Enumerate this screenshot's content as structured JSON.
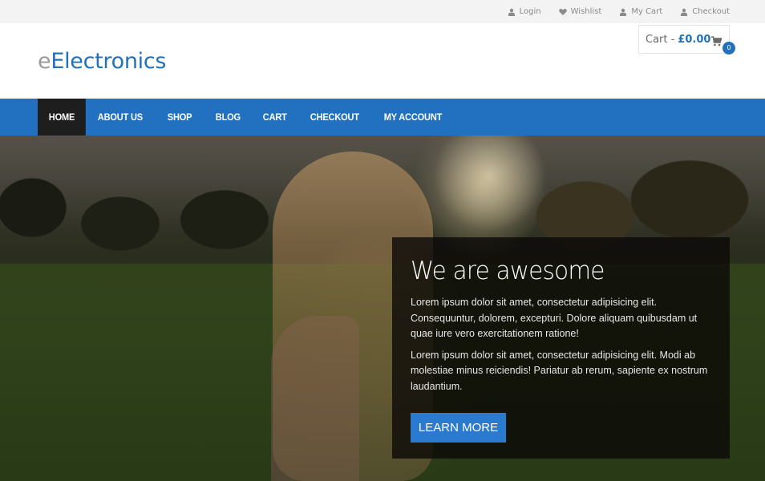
{
  "topbar": {
    "links": [
      {
        "label": "Login",
        "icon": "user-icon"
      },
      {
        "label": "Wishlist",
        "icon": "heart-icon"
      },
      {
        "label": "My Cart",
        "icon": "user-icon"
      },
      {
        "label": "Checkout",
        "icon": "user-icon"
      }
    ]
  },
  "header": {
    "logo_prefix": "e",
    "logo_rest": "Electronics",
    "cart": {
      "label": "Cart -",
      "amount": "£0.00",
      "count": "0",
      "icon": "shopping-cart-icon"
    }
  },
  "nav": {
    "items": [
      {
        "label": "HOME",
        "active": true
      },
      {
        "label": "ABOUT US",
        "active": false
      },
      {
        "label": "SHOP",
        "active": false
      },
      {
        "label": "BLOG",
        "active": false
      },
      {
        "label": "CART",
        "active": false
      },
      {
        "label": "CHECKOUT",
        "active": false
      },
      {
        "label": "MY ACCOUNT",
        "active": false
      }
    ]
  },
  "hero": {
    "title": "We are awesome",
    "paragraphs": [
      "Lorem ipsum dolor sit amet, consectetur adipisicing elit. Consequuntur, dolorem, excepturi. Dolore aliquam quibusdam ut quae iure vero exercitationem ratione!",
      "Lorem ipsum dolor sit amet, consectetur adipisicing elit. Modi ab molestiae minus reiciendis! Pariatur ab rerum, sapiente ex nostrum laudantium."
    ],
    "button_label": "LEARN MORE"
  },
  "colors": {
    "brand_blue": "#2271b9",
    "nav_blue": "#2271c1",
    "nav_active": "#1e1e1e",
    "button_blue": "#2a7bd0",
    "topbar_bg": "#f3f3f3"
  }
}
